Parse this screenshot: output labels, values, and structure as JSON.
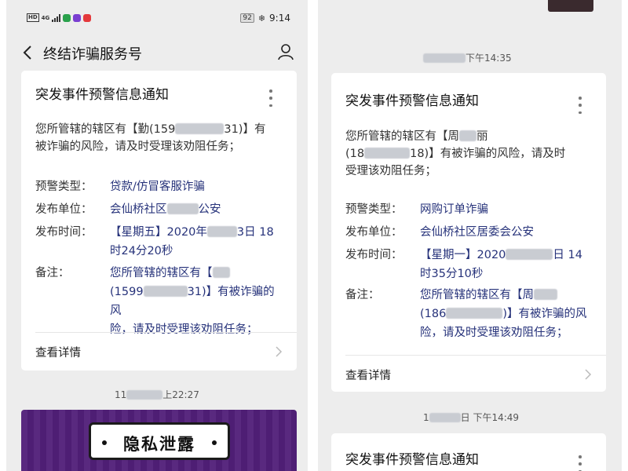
{
  "status_bar": {
    "network_tag": "HD",
    "network_type": "4G",
    "battery": "92",
    "time": "9:14"
  },
  "header": {
    "title": "终结诈骗服务号"
  },
  "left": {
    "card": {
      "title": "突发事件预警信息通知",
      "body_line1_a": "您所管辖的辖区有【勤(159",
      "body_line1_b": "31)】有",
      "body_line2": "被诈骗的风险，请及时受理该劝阻任务；",
      "fields": [
        {
          "label": "预警类型：",
          "line1": "贷款/仿冒客服诈骗",
          "line2": ""
        },
        {
          "label": "发布单位：",
          "line1a": "会仙桥社区",
          "line1b": "公安"
        },
        {
          "label": "发布时间：",
          "line1a": "【星期五】2020年",
          "line1b": "3日 18",
          "line2": "时24分20秒"
        },
        {
          "label": "备注：",
          "line1": "您所管辖的辖区有【",
          "line2a": "(1599",
          "line2b": "31)】有被诈骗的风",
          "line3": "险，请及时受理该劝阻任务；"
        }
      ],
      "detail_label": "查看详情"
    },
    "timestamp_a": "11",
    "timestamp_b": "上22:27",
    "banner_text": "隐私泄露"
  },
  "right": {
    "timestamp_top": "下午14:35",
    "card": {
      "title": "突发事件预警信息通知",
      "body_line1": "您所管辖的辖区有【周",
      "body_line1_b": "丽",
      "body_line2_a": "(18",
      "body_line2_b": "18)】有被诈骗的风险，请及时",
      "body_line3": "受理该劝阻任务；",
      "fields": [
        {
          "label": "预警类型：",
          "line1": "网购订单诈骗"
        },
        {
          "label": "发布单位：",
          "line1": "会仙桥社区居委会公安"
        },
        {
          "label": "发布时间：",
          "line1a": "【星期一】2020",
          "line1b": "日 14",
          "line2": "时35分10秒"
        },
        {
          "label": "备注：",
          "line1": "您所管辖的辖区有【周",
          "line2a": "(186",
          "line2b": ")】有被诈骗的风",
          "line3": "险，请及时受理该劝阻任务；"
        }
      ],
      "detail_label": "查看详情"
    },
    "timestamp_bottom_a": "1",
    "timestamp_bottom_b": "日 下午14:49",
    "card2_title": "突发事件预警信息通知"
  }
}
